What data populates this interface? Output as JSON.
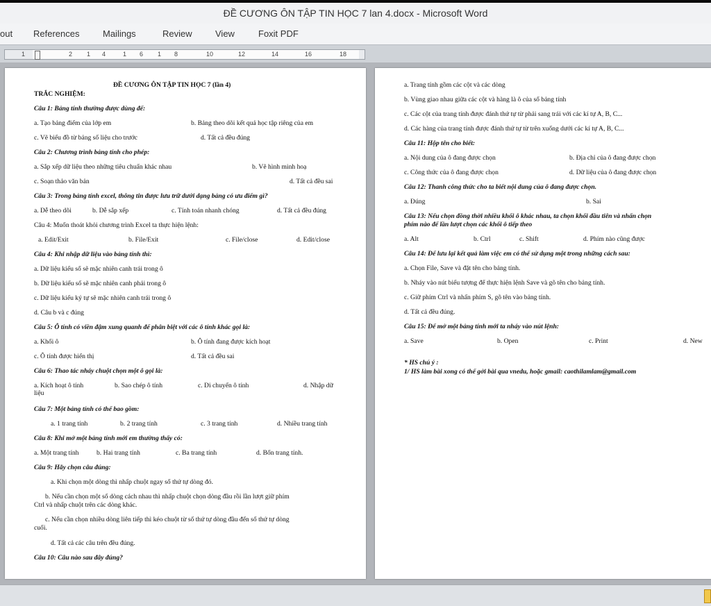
{
  "window": {
    "title": "ĐỀ CƯƠNG ÔN TẬP TIN HỌC 7 lan 4.docx - Microsoft Word"
  },
  "ribbon": {
    "tabs": [
      "out",
      "References",
      "Mailings",
      "Review",
      "View",
      "Foxit PDF"
    ]
  },
  "ruler": {
    "ticks": [
      "1",
      "2",
      "1",
      "4",
      "1",
      "6",
      "1",
      "8",
      "10",
      "12",
      "14",
      "16",
      "18"
    ]
  },
  "page1": {
    "lines": [
      "ĐỀ CƯƠNG ÔN TẬP TIN HỌC 7 (lần 4)",
      "TRẮC NGHIỆM:",
      "Câu 1: Bảng tính thường được dùng để:",
      "a. Tạo bảng điểm của lớp em",
      "b. Bảng theo dõi kết quả học tập riêng của em",
      "c. Vẽ biểu đồ từ bảng số liệu cho trước",
      "d. Tất cả đều đúng",
      "Câu 2: Chương trình bảng tính cho phép:",
      "a. Sắp xếp dữ liệu theo những tiêu chuẩn khác nhau",
      "b. Vẽ hình minh hoạ",
      "c. Soạn thảo văn bản",
      "d. Tất cả đều sai",
      "Câu 3: Trong bảng tính excel, thông tin được lưu trữ dưới dạng bảng có ưu điểm gì?",
      "a. Dễ theo dõi",
      "b. Dễ sắp xếp",
      "c. Tính toán nhanh chóng",
      "d. Tất cả đều đúng",
      "Câu 4: Muốn thoát khỏi chương trình Excel ta thực hiện lệnh:",
      "a. Edit/Exit",
      "b. File/Exit",
      "c. File/close",
      "d. Edit/close",
      "Câu 4: Khi nhập dữ liệu vào bảng tính thì:",
      "a. Dữ liệu kiểu số sẽ mặc nhiên canh trái trong ô",
      "b. Dữ liệu kiểu số sẽ mặc nhiên canh phải trong ô",
      "c. Dữ liệu kiểu ký tự sẽ mặc nhiên canh trái trong ô",
      "d. Câu b và c đúng",
      "Câu 5: Ô tính có viền đậm xung quanh để phân biệt với các ô tính khác gọi là:",
      "a. Khối ô",
      "b. Ô tính đang được kích hoạt",
      "c. Ô tính được hiển thị",
      "d. Tất cả đều sai",
      "Câu 6: Thao tác nháy chuột chọn một ô gọi là:",
      "a. Kích hoạt ô tính",
      "b. Sao chép ô tính",
      "c. Di chuyển ô tính",
      "d. Nhập dữ",
      "liệu",
      "Câu 7: Một bảng tính có thể bao gồm:",
      "a. 1 trang tính",
      "b. 2 trang tính",
      "c. 3 trang tính",
      "d. Nhiều trang tính",
      "Câu 8: Khi mở một bảng tính mới em thường thấy có:",
      "a. Một trang tính",
      "b. Hai trang tính",
      "c. Ba trang tính",
      "d. Bốn trang tính.",
      "Câu 9: Hãy chọn câu đúng:",
      "a. Khi chọn một dòng thì nhấp chuột ngay số thứ tự dòng đó.",
      "b. Nếu cần chọn một số dòng cách nhau thì nhấp chuột chọn dòng đầu rồi lần lượt giữ phím",
      "Ctrl và nhấp chuột trên các dòng khác.",
      "c. Nếu cần chọn nhiều dòng liên tiếp thì kéo chuột từ số thứ tự dòng đầu đến số thứ tự dòng",
      "cuối.",
      "d. Tất cả các câu trên đều đúng.",
      "Câu 10: Câu nào sau đây đúng?"
    ]
  },
  "page2": {
    "lines": [
      "a. Trang tính gồm các cột và các dòng",
      "b. Vùng giao nhau giữa các cột và hàng là ô của số bảng tính",
      "c. Các cột của trang tính được đánh thứ tự từ phải sang trái với các kí tự A, B, C...",
      "d. Các hàng của trang tính được đánh thứ tự từ trên xuống dưới các kí tự A, B, C...",
      "Câu 11: Hộp tên cho biết:",
      "a. Nội dung của ô đang được chọn",
      "b. Địa chỉ của ô đang được chọn",
      "c. Công thức của ô đang được chọn",
      "d. Dữ liệu của ô đang được chọn",
      "Câu 12: Thanh công thức cho ta biết nội dung của ô đang được chọn.",
      "a. Đúng",
      "b. Sai",
      "Câu 13: Nếu chọn đồng thời nhiều khối ô khác nhau, ta chọn khối đầu tiên và nhấn chọn",
      "phím nào để lần lượt chọn các khối ô tiếp theo",
      "a. Alt",
      "b. Ctrl",
      "c. Shift",
      "d. Phím nào cũng được",
      "Câu 14: Để lưu lại kết quả làm việc em có thể sử dụng một trong những cách sau:",
      "a. Chọn File, Save và đặt tên cho bảng tính.",
      "b. Nháy vào nút biểu tượng để thực hiện lệnh Save và gõ tên cho bảng tính.",
      "c. Giữ phím Ctrl và nhấn phím S, gõ tên vào bảng tính.",
      "d. Tất cả đều đúng.",
      "Câu 15: Để mở một bảng tính mới ta nháy vào nút lệnh:",
      "a. Save",
      "b. Open",
      "c. Print",
      "d. New",
      "* HS chú ý :",
      "1/ HS làm bài xong có thể gởi bài qua vnedu, hoặc gmail: caothilamlam@gmail.com"
    ]
  }
}
